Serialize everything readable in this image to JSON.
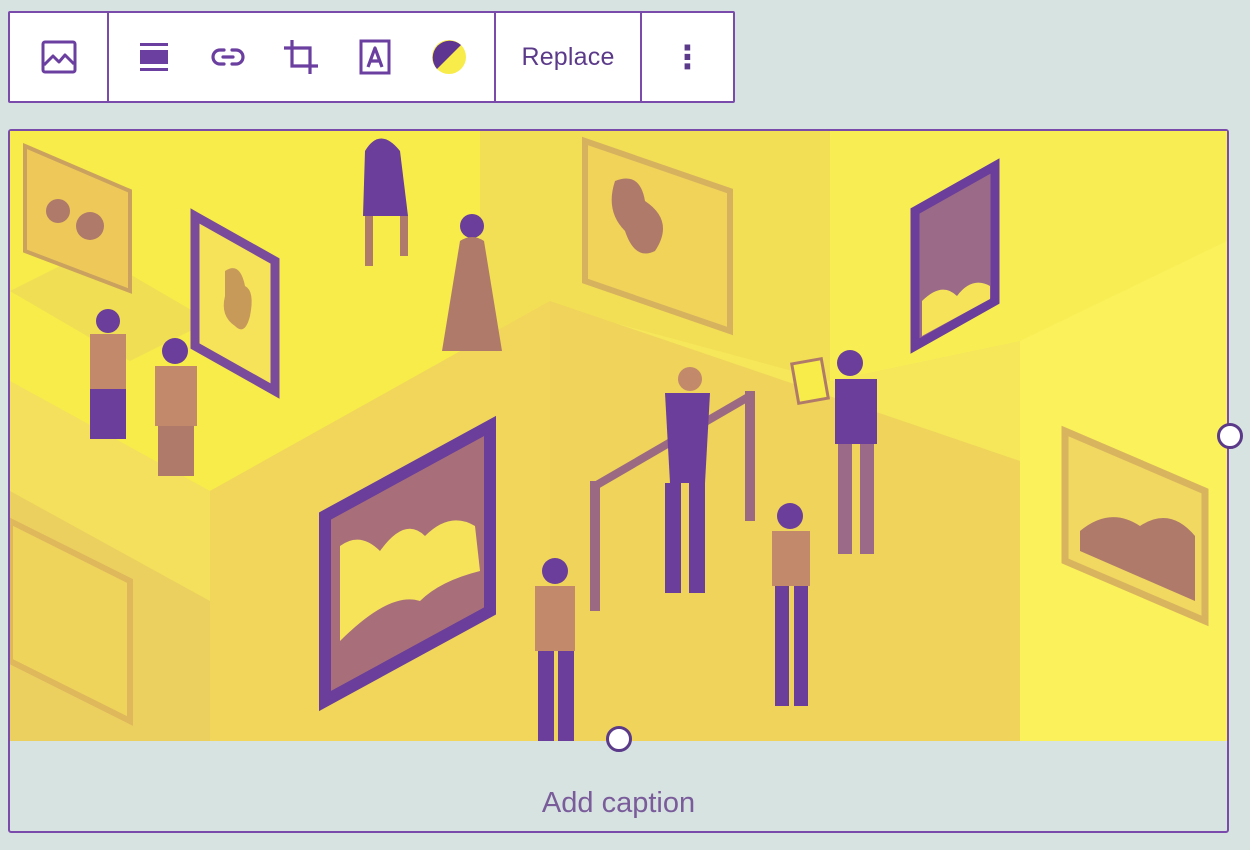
{
  "toolbar": {
    "block_icon": "image-icon",
    "tools": [
      {
        "name": "align-icon"
      },
      {
        "name": "link-icon"
      },
      {
        "name": "crop-icon"
      },
      {
        "name": "text-overlay-icon"
      },
      {
        "name": "duotone-icon"
      }
    ],
    "replace_label": "Replace",
    "more_label": "⋮"
  },
  "image": {
    "subject": "isometric art gallery illustration in yellow and purple duotone"
  },
  "caption": {
    "placeholder": "Add caption"
  },
  "colors": {
    "accent": "#7b4bab",
    "background": "#d6e3e1",
    "duotone_highlight": "#f7ec4a",
    "duotone_shadow": "#6a3e9a"
  }
}
